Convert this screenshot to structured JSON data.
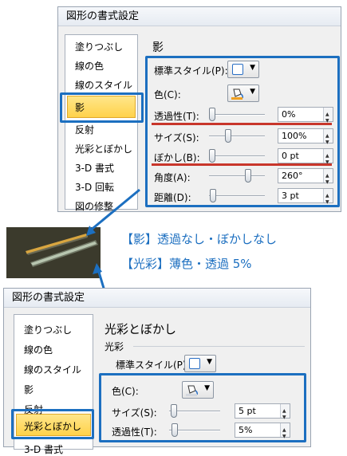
{
  "top_dialog": {
    "title": "図形の書式設定",
    "sidebar": [
      "塗りつぶし",
      "線の色",
      "線のスタイル",
      "影",
      "反射",
      "光彩とぼかし",
      "3-D 書式",
      "3-D 回転",
      "図の修整"
    ],
    "selected_item": "影",
    "section_title": "影",
    "rows": {
      "preset_label": "標準スタイル(P):",
      "color_label": "色(C):",
      "transparency_label": "透過性(T):",
      "transparency_value": "0%",
      "transparency_level": 0,
      "size_label": "サイズ(S):",
      "size_value": "100%",
      "size_level": 0.33,
      "blur_label": "ぼかし(B):",
      "blur_value": "0 pt",
      "blur_level": 0,
      "angle_label": "角度(A):",
      "angle_value": "260°",
      "angle_level": 0.72,
      "distance_label": "距離(D):",
      "distance_value": "3 pt",
      "distance_level": 0.02
    }
  },
  "captions": {
    "shadow": "【影】透過なし・ぼかしなし",
    "glow": "【光彩】薄色・透過 5%"
  },
  "bottom_dialog": {
    "title": "図形の書式設定",
    "sidebar": [
      "塗りつぶし",
      "線の色",
      "線のスタイル",
      "影",
      "反射",
      "光彩とぼかし",
      "3-D 書式"
    ],
    "selected_item": "光彩とぼかし",
    "section_title": "光彩とぼかし",
    "sub_title": "光彩",
    "rows": {
      "preset_label": "標準スタイル(P):",
      "color_label": "色(C):",
      "size_label": "サイズ(S):",
      "size_value": "5 pt",
      "size_level": 0.03,
      "transparency_label": "透過性(T):",
      "transparency_value": "5%",
      "transparency_level": 0.05
    }
  },
  "colors": {
    "accent_blue": "#1c6fc0",
    "highlight_red": "#c8362b",
    "selection_yellow": "#ffd24a"
  }
}
